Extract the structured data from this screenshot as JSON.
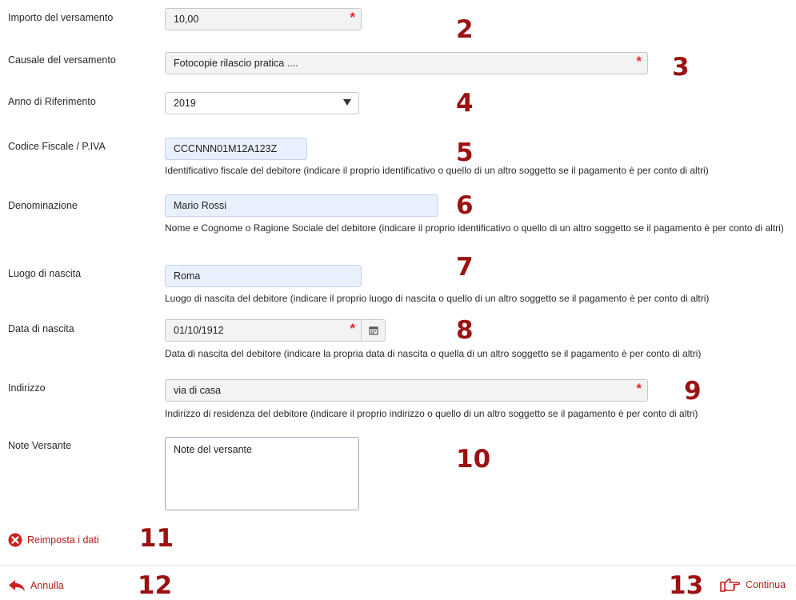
{
  "form": {
    "importo": {
      "label": "Importo del versamento",
      "value": "10,00"
    },
    "causale": {
      "label": "Causale del versamento",
      "value": "Fotocopie rilascio pratica ...."
    },
    "anno": {
      "label": "Anno di Riferimento",
      "value": "2019"
    },
    "codice_fiscale": {
      "label": "Codice Fiscale / P.IVA",
      "value": "CCCNNN01M12A123Z",
      "help": "Identificativo fiscale del debitore (indicare il proprio identificativo o quello di un altro soggetto se il pagamento è per conto di altri)"
    },
    "denominazione": {
      "label": "Denominazione",
      "value": "Mario Rossi",
      "help": "Nome e Cognome o Ragione Sociale del debitore (indicare il proprio identificativo o quello di un altro soggetto se il pagamento è per conto di altri)"
    },
    "luogo_nascita": {
      "label": "Luogo di nascita",
      "value": "Roma",
      "help": "Luogo di nascita del debitore (indicare il proprio luogo di nascita o quello di un altro soggetto se il pagamento è per conto di altri)"
    },
    "data_nascita": {
      "label": "Data di nascita",
      "value": "01/10/1912",
      "help": "Data di nascita del debitore (indicare la propria data di nascita o quella di un altro soggetto se il pagamento è per conto di altri)"
    },
    "indirizzo": {
      "label": "Indirizzo",
      "value": "via di casa",
      "help": "Indirizzo di residenza del debitore (indicare il proprio indirizzo o quello di un altro soggetto se il pagamento è per conto di altri)"
    },
    "note": {
      "label": "Note Versante",
      "value": "Note del versante"
    },
    "required_mark": "*"
  },
  "actions": {
    "reset": "Reimposta i dati",
    "cancel": "Annulla",
    "continue": "Continua"
  },
  "annotations": [
    "2",
    "3",
    "4",
    "5",
    "6",
    "7",
    "8",
    "9",
    "10",
    "11",
    "12",
    "13"
  ],
  "colors": {
    "accent": "#b61b1b",
    "annotation": "#9b1212",
    "required": "#e8262b"
  },
  "icons": {
    "reset": "reset-circle-x-icon",
    "cancel": "back-arrow-icon",
    "continue": "pointing-hand-icon",
    "calendar": "calendar-icon",
    "dropdown": "chevron-down-icon"
  }
}
